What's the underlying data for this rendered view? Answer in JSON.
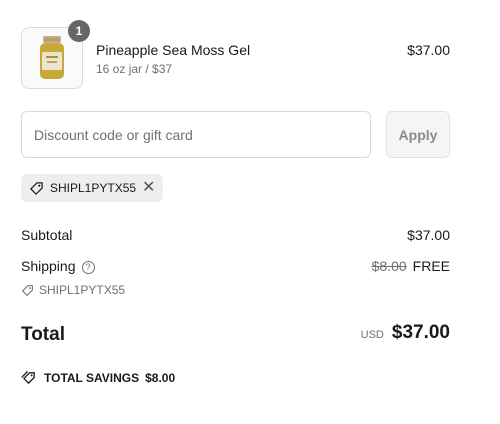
{
  "product": {
    "name": "Pineapple Sea Moss Gel",
    "variant": "16 oz jar / $37",
    "price": "$37.00",
    "quantity": "1"
  },
  "discount": {
    "placeholder": "Discount code or gift card",
    "apply_label": "Apply",
    "applied_code": "SHIPL1PYTX55"
  },
  "summary": {
    "subtotal_label": "Subtotal",
    "subtotal_value": "$37.00",
    "shipping_label": "Shipping",
    "shipping_original": "$8.00",
    "shipping_value": "FREE",
    "shipping_code": "SHIPL1PYTX55",
    "total_label": "Total",
    "currency": "USD",
    "total_value": "$37.00",
    "savings_label": "TOTAL SAVINGS",
    "savings_value": "$8.00"
  },
  "icons": {
    "tag": "tag-icon",
    "close": "close-icon",
    "help": "help-circle-icon",
    "tags": "tags-icon"
  }
}
